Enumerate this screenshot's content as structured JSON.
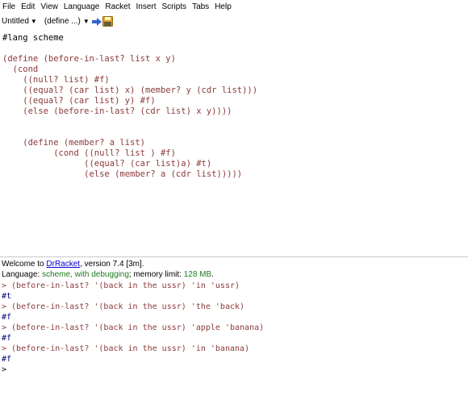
{
  "menu": [
    "File",
    "Edit",
    "View",
    "Language",
    "Racket",
    "Insert",
    "Scripts",
    "Tabs",
    "Help"
  ],
  "toolbar": {
    "file_dropdown": "Untitled",
    "define_dropdown": "(define ...)"
  },
  "editor": {
    "lines": [
      "#lang scheme",
      "",
      "(define (before-in-last? list x y)",
      "  (cond",
      "    ((null? list) #f)",
      "    ((equal? (car list) x) (member? y (cdr list)))",
      "    ((equal? (car list) y) #f)",
      "    (else (before-in-last? (cdr list) x y))))",
      "",
      "",
      "    (define (member? a list)",
      "          (cond ((null? list ) #f)",
      "                ((equal? (car list)a) #t)",
      "                (else (member? a (cdr list)))))"
    ]
  },
  "repl": {
    "welcome_prefix": "Welcome to ",
    "welcome_link": "DrRacket",
    "welcome_suffix": ", version 7.4 [3m].",
    "language_prefix": "Language: ",
    "language_value": "scheme, with debugging",
    "memory_prefix": "; memory limit: ",
    "memory_value": "128 MB",
    "memory_suffix": ".",
    "lines": [
      "> (before-in-last? '(back in the ussr) 'in 'ussr)",
      "#t",
      "> (before-in-last? '(back in the ussr) 'the 'back)",
      "#f",
      "> (before-in-last? '(back in the ussr) 'apple 'banana)",
      "#f",
      "> (before-in-last? '(back in the ussr) 'in 'banana)",
      "#f",
      ">"
    ]
  },
  "colors": {
    "link": "#0000cc",
    "language_value": "#1e7a1e",
    "code_paren": "#8b3a3a",
    "output": "#000080"
  }
}
